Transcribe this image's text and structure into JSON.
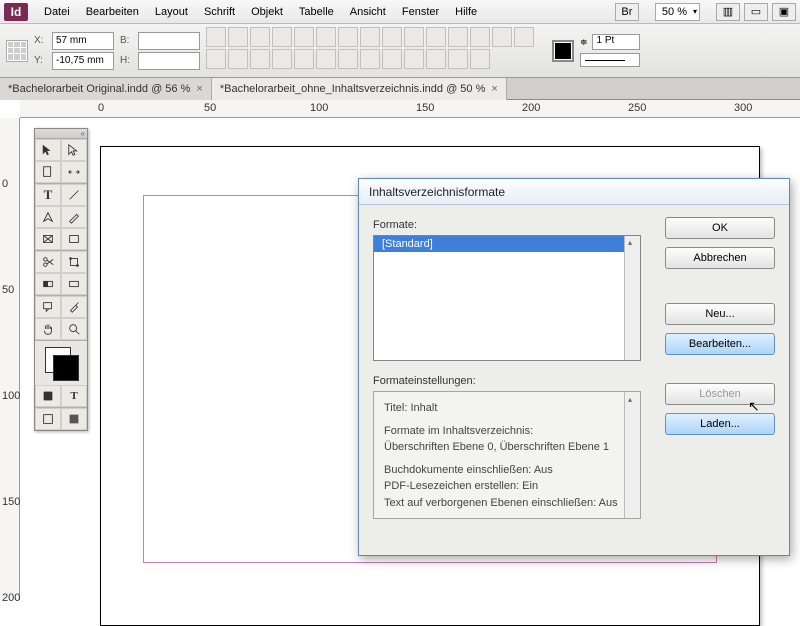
{
  "app": {
    "logo_text": "Id"
  },
  "menu": {
    "items": [
      "Datei",
      "Bearbeiten",
      "Layout",
      "Schrift",
      "Objekt",
      "Tabelle",
      "Ansicht",
      "Fenster",
      "Hilfe"
    ],
    "br_label": "Br",
    "zoom": "50 %"
  },
  "control": {
    "x_label": "X:",
    "x_value": "57 mm",
    "y_label": "Y:",
    "y_value": "-10,75 mm",
    "b_label": "B:",
    "b_value": "",
    "h_label": "H:",
    "h_value": "",
    "stroke_weight": "1 Pt"
  },
  "tabs": [
    {
      "label": "*Bachelorarbeit Original.indd @ 56 %",
      "active": false
    },
    {
      "label": "*Bachelorarbeit_ohne_Inhaltsverzeichnis.indd @ 50 %",
      "active": true
    }
  ],
  "ruler_h": [
    "0",
    "50",
    "100",
    "150",
    "200",
    "250",
    "300"
  ],
  "ruler_v": [
    "0",
    "50",
    "100",
    "150",
    "200"
  ],
  "dialog": {
    "title": "Inhaltsverzeichnisformate",
    "formats_label": "Formate:",
    "selected_format": "[Standard]",
    "settings_label": "Formateinstellungen:",
    "settings_title": "Titel: Inhalt",
    "settings_line1": "Formate im Inhaltsverzeichnis:",
    "settings_line2": "Überschriften Ebene 0, Überschriften Ebene 1",
    "settings_line3": "Buchdokumente einschließen: Aus",
    "settings_line4": "PDF-Lesezeichen erstellen: Ein",
    "settings_line5": "Text auf verborgenen Ebenen einschließen: Aus",
    "buttons": {
      "ok": "OK",
      "cancel": "Abbrechen",
      "new": "Neu...",
      "edit": "Bearbeiten...",
      "delete": "Löschen",
      "load": "Laden..."
    }
  }
}
